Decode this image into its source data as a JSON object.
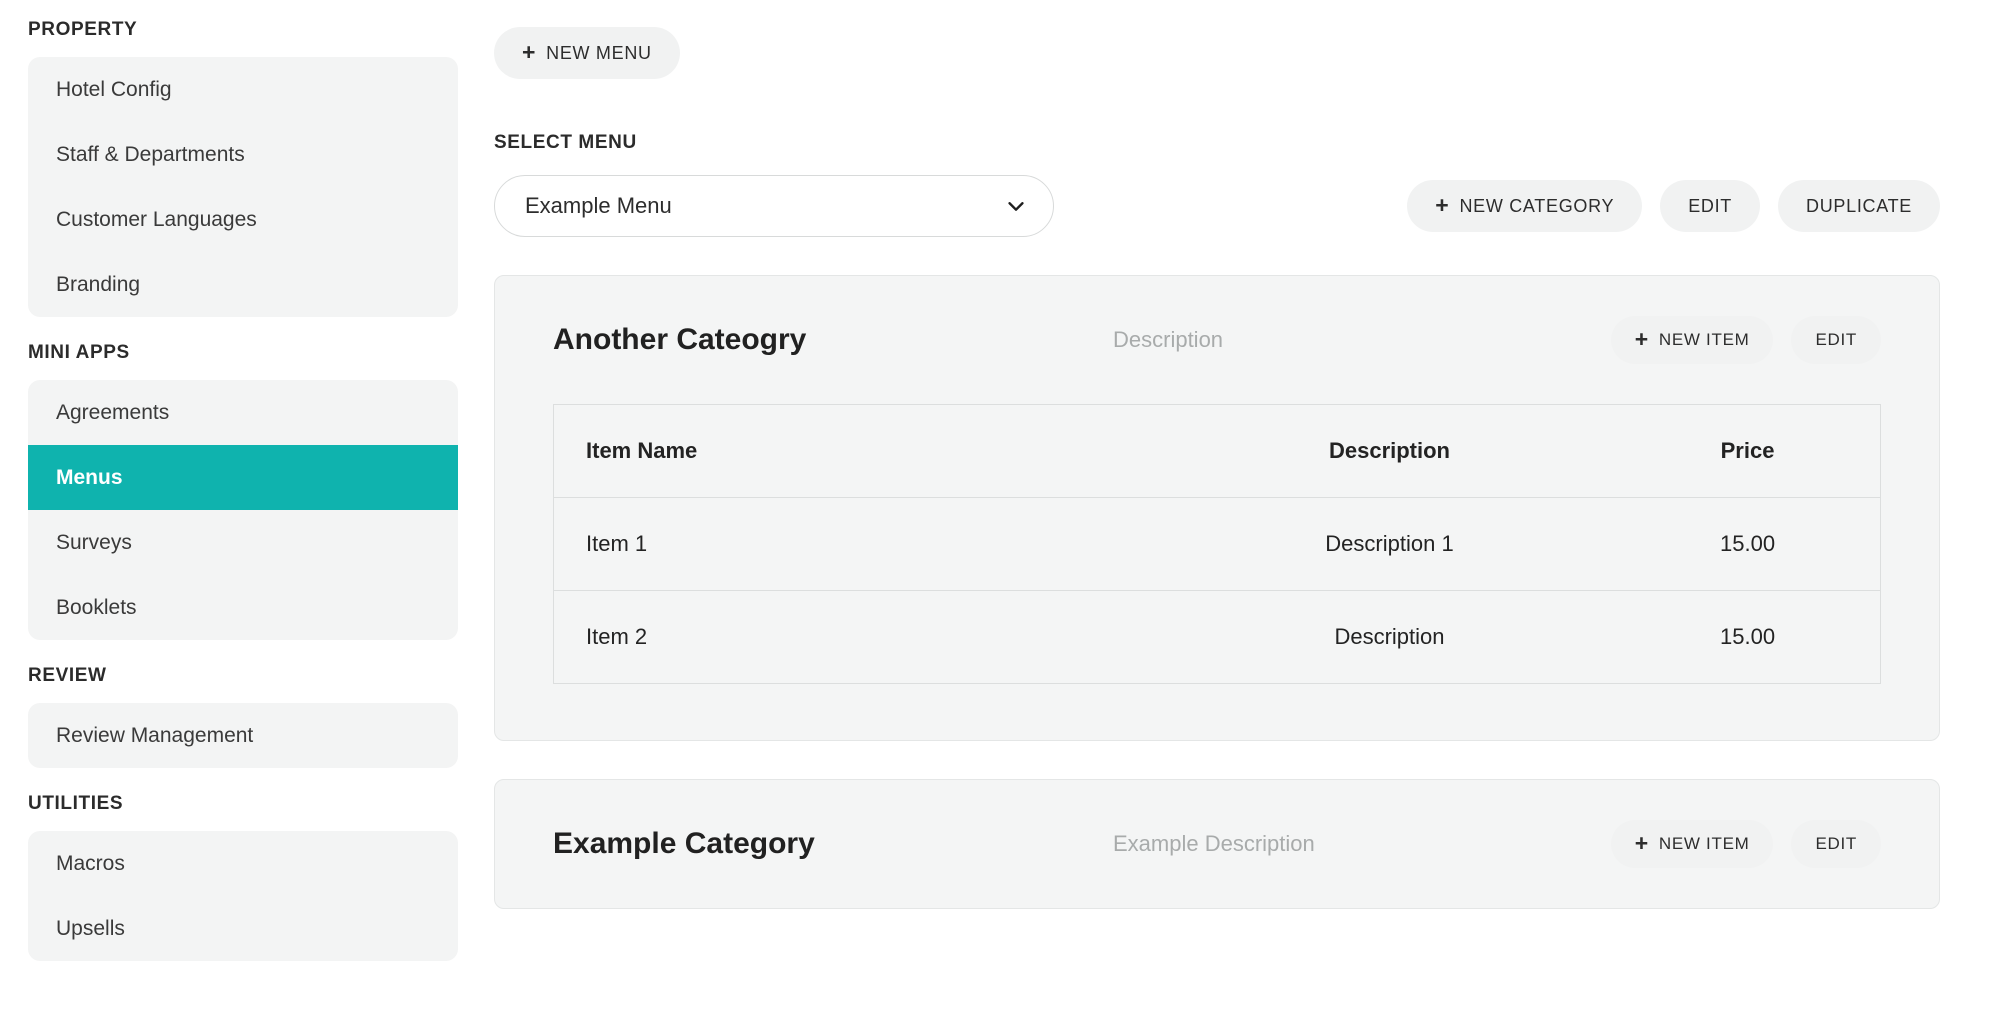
{
  "sidebar": {
    "sections": [
      {
        "label": "PROPERTY",
        "items": [
          {
            "label": "Hotel Config",
            "active": false
          },
          {
            "label": "Staff & Departments",
            "active": false
          },
          {
            "label": "Customer Languages",
            "active": false
          },
          {
            "label": "Branding",
            "active": false
          }
        ]
      },
      {
        "label": "MINI APPS",
        "items": [
          {
            "label": "Agreements",
            "active": false
          },
          {
            "label": "Menus",
            "active": true
          },
          {
            "label": "Surveys",
            "active": false
          },
          {
            "label": "Booklets",
            "active": false
          }
        ]
      },
      {
        "label": "REVIEW",
        "items": [
          {
            "label": "Review Management",
            "active": false
          }
        ]
      },
      {
        "label": "UTILITIES",
        "items": [
          {
            "label": "Macros",
            "active": false
          },
          {
            "label": "Upsells",
            "active": false
          }
        ]
      }
    ]
  },
  "toolbar": {
    "new_menu_label": "NEW MENU",
    "plus_glyph": "+"
  },
  "select_menu": {
    "label": "SELECT MENU",
    "value": "Example Menu",
    "chevron_icon": "chevron-down-icon",
    "actions": {
      "new_category_label": "NEW CATEGORY",
      "edit_label": "EDIT",
      "duplicate_label": "DUPLICATE"
    }
  },
  "categories": [
    {
      "title": "Another Cateogry",
      "description": "Description",
      "new_item_label": "NEW ITEM",
      "edit_label": "EDIT",
      "table": {
        "headers": {
          "name": "Item Name",
          "description": "Description",
          "price": "Price"
        },
        "rows": [
          {
            "name": "Item 1",
            "description": "Description 1",
            "price": "15.00"
          },
          {
            "name": "Item 2",
            "description": "Description",
            "price": "15.00"
          }
        ]
      }
    },
    {
      "title": "Example Category",
      "description": "Example Description",
      "new_item_label": "NEW ITEM",
      "edit_label": "EDIT",
      "table": null
    }
  ],
  "colors": {
    "accent_teal": "#0fb3ae",
    "panel_gray": "#f3f4f4",
    "card_gray": "#f4f5f5",
    "border_gray": "#dcdede",
    "muted_text": "#a8abab"
  }
}
